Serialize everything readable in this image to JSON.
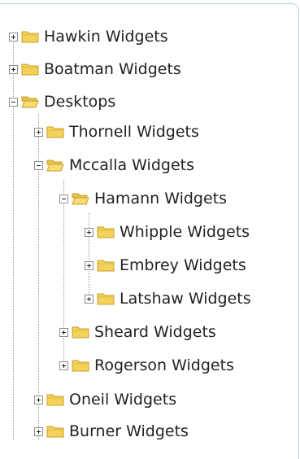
{
  "tree": {
    "nodes": [
      {
        "label": "Hawkin Widgets",
        "state": "collapsed",
        "depth": 0
      },
      {
        "label": "Boatman Widgets",
        "state": "collapsed",
        "depth": 0
      },
      {
        "label": "Desktops",
        "state": "expanded",
        "depth": 0
      },
      {
        "label": "Thornell Widgets",
        "state": "collapsed",
        "depth": 1
      },
      {
        "label": "Mccalla Widgets",
        "state": "expanded",
        "depth": 1
      },
      {
        "label": "Hamann Widgets",
        "state": "expanded",
        "depth": 2
      },
      {
        "label": "Whipple Widgets",
        "state": "collapsed",
        "depth": 3
      },
      {
        "label": "Embrey Widgets",
        "state": "collapsed",
        "depth": 3
      },
      {
        "label": "Latshaw Widgets",
        "state": "collapsed",
        "depth": 3
      },
      {
        "label": "Sheard Widgets",
        "state": "collapsed",
        "depth": 2
      },
      {
        "label": "Rogerson Widgets",
        "state": "collapsed",
        "depth": 2
      },
      {
        "label": "Oneil Widgets",
        "state": "collapsed",
        "depth": 1
      },
      {
        "label": "Burner Widgets",
        "state": "collapsed",
        "depth": 1
      }
    ]
  },
  "colors": {
    "folder_fill": "#f3d25a",
    "folder_edge": "#c9a028",
    "panel_border": "#bcd3ea"
  },
  "icons": {
    "collapsed_toggle": "plus-box-icon",
    "expanded_toggle": "minus-box-icon",
    "closed_folder": "folder-closed-icon",
    "open_folder": "folder-open-icon"
  }
}
